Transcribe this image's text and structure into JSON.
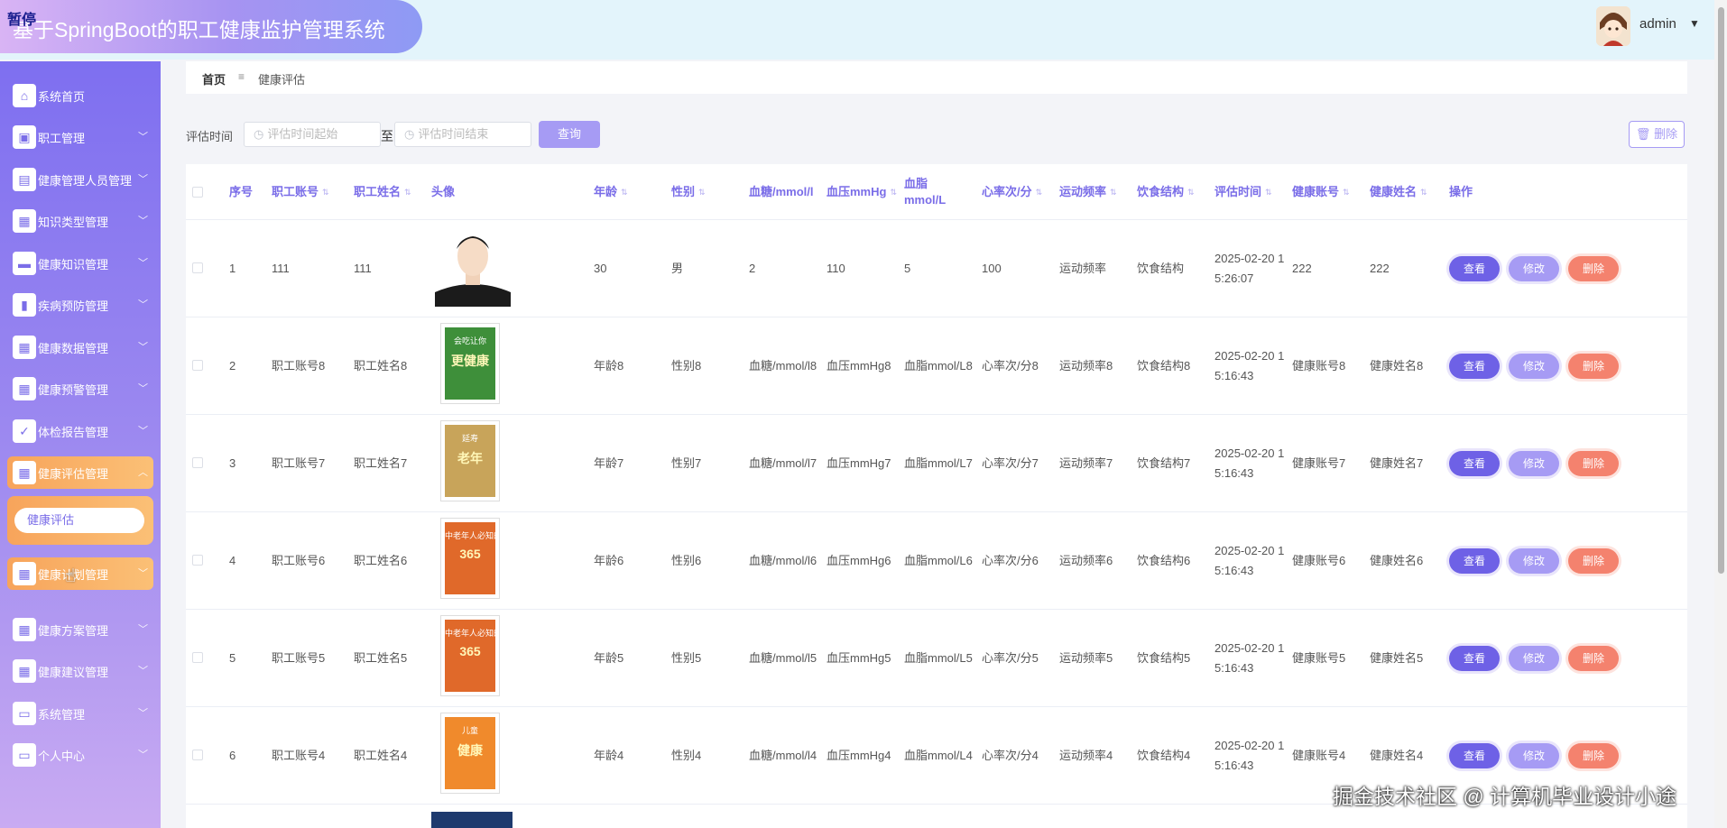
{
  "header": {
    "pause_tag": "暂停",
    "title": "基于SpringBoot的职工健康监护管理系统",
    "user": "admin"
  },
  "sidebar": {
    "items": [
      {
        "label": "系统首页",
        "icon": "home-icon"
      },
      {
        "label": "职工管理",
        "icon": "user-icon"
      },
      {
        "label": "健康管理人员管理",
        "icon": "briefcase-icon"
      },
      {
        "label": "知识类型管理",
        "icon": "grid-icon"
      },
      {
        "label": "健康知识管理",
        "icon": "board-icon"
      },
      {
        "label": "疾病预防管理",
        "icon": "bar-chart-icon"
      },
      {
        "label": "健康数据管理",
        "icon": "grid-icon"
      },
      {
        "label": "健康预警管理",
        "icon": "grid-icon"
      },
      {
        "label": "体检报告管理",
        "icon": "clipboard-icon"
      },
      {
        "label": "健康评估管理",
        "icon": "grid-icon"
      },
      {
        "label": "健康计划管理",
        "icon": "grid-icon"
      },
      {
        "label": "健康方案管理",
        "icon": "grid-icon"
      },
      {
        "label": "健康建议管理",
        "icon": "apps-icon"
      },
      {
        "label": "系统管理",
        "icon": "monitor-icon"
      },
      {
        "label": "个人中心",
        "icon": "wallet-icon"
      }
    ],
    "sub_item": "健康评估"
  },
  "breadcrumb": {
    "home": "首页",
    "separator": "≡",
    "current": "健康评估"
  },
  "filter": {
    "label": "评估时间",
    "start_placeholder": "评估时间起始",
    "to": "至",
    "end_placeholder": "评估时间结束",
    "query": "查询",
    "delete": "删除"
  },
  "table": {
    "headers": [
      "序号",
      "职工账号",
      "职工姓名",
      "头像",
      "年龄",
      "性别",
      "血糖/mmol/l",
      "血压mmHg",
      "血脂mmol/L",
      "心率次/分",
      "运动频率",
      "饮食结构",
      "评估时间",
      "健康账号",
      "健康姓名",
      "操作"
    ],
    "actions": {
      "view": "查看",
      "edit": "修改",
      "delete": "删除"
    },
    "rows": [
      {
        "no": "1",
        "account": "111",
        "name": "111",
        "age": "30",
        "gender": "男",
        "sugar": "2",
        "pressure": "110",
        "lipid": "5",
        "heart": "100",
        "exercise": "运动频率",
        "diet": "饮食结构",
        "time": "2025-02-20 15:26:07",
        "h_account": "222",
        "h_name": "222"
      },
      {
        "no": "2",
        "account": "职工账号8",
        "name": "职工姓名8",
        "age": "年龄8",
        "gender": "性别8",
        "sugar": "血糖/mmol/l8",
        "pressure": "血压mmHg8",
        "lipid": "血脂mmol/L8",
        "heart": "心率次/分8",
        "exercise": "运动频率8",
        "diet": "饮食结构8",
        "time": "2025-02-20 15:16:43",
        "h_account": "健康账号8",
        "h_name": "健康姓名8"
      },
      {
        "no": "3",
        "account": "职工账号7",
        "name": "职工姓名7",
        "age": "年龄7",
        "gender": "性别7",
        "sugar": "血糖/mmol/l7",
        "pressure": "血压mmHg7",
        "lipid": "血脂mmol/L7",
        "heart": "心率次/分7",
        "exercise": "运动频率7",
        "diet": "饮食结构7",
        "time": "2025-02-20 15:16:43",
        "h_account": "健康账号7",
        "h_name": "健康姓名7"
      },
      {
        "no": "4",
        "account": "职工账号6",
        "name": "职工姓名6",
        "age": "年龄6",
        "gender": "性别6",
        "sugar": "血糖/mmol/l6",
        "pressure": "血压mmHg6",
        "lipid": "血脂mmol/L6",
        "heart": "心率次/分6",
        "exercise": "运动频率6",
        "diet": "饮食结构6",
        "time": "2025-02-20 15:16:43",
        "h_account": "健康账号6",
        "h_name": "健康姓名6"
      },
      {
        "no": "5",
        "account": "职工账号5",
        "name": "职工姓名5",
        "age": "年龄5",
        "gender": "性别5",
        "sugar": "血糖/mmol/l5",
        "pressure": "血压mmHg5",
        "lipid": "血脂mmol/L5",
        "heart": "心率次/分5",
        "exercise": "运动频率5",
        "diet": "饮食结构5",
        "time": "2025-02-20 15:16:43",
        "h_account": "健康账号5",
        "h_name": "健康姓名5"
      },
      {
        "no": "6",
        "account": "职工账号4",
        "name": "职工姓名4",
        "age": "年龄4",
        "gender": "性别4",
        "sugar": "血糖/mmol/l4",
        "pressure": "血压mmHg4",
        "lipid": "血脂mmol/L4",
        "heart": "心率次/分4",
        "exercise": "运动频率4",
        "diet": "饮食结构4",
        "time": "2025-02-20 15:16:43",
        "h_account": "健康账号4",
        "h_name": "健康姓名4"
      }
    ],
    "book_covers": [
      {
        "title_line": "会吃让你",
        "subtitle_line": "更健康",
        "color": "#3e8f3a"
      },
      {
        "title_line": "延寿",
        "subtitle_line": "老年",
        "color": "#c8a45a"
      },
      {
        "title_line": "中老年人必知的",
        "subtitle_line": "365",
        "color": "#e0692a"
      },
      {
        "title_line": "中老年人必知的",
        "subtitle_line": "365",
        "color": "#e0692a"
      },
      {
        "title_line": "儿童",
        "subtitle_line": "健康",
        "color": "#f08a2c"
      }
    ]
  },
  "watermark": "掘金技术社区 @ 计算机毕业设计小途",
  "colors": {
    "accent": "#7a6de8",
    "orange": "#f7a45b",
    "delete": "#f4826e"
  }
}
